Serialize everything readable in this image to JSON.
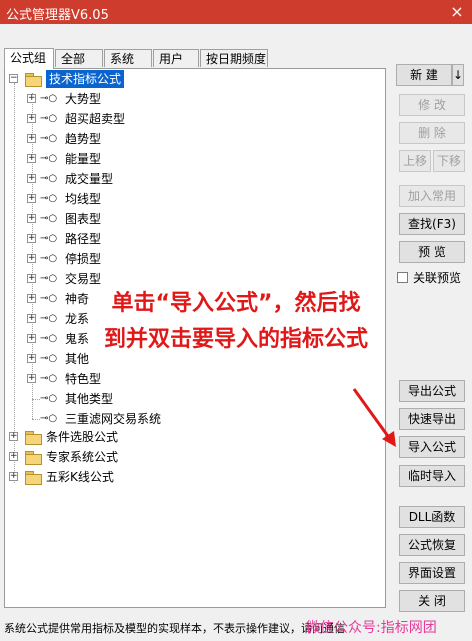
{
  "window": {
    "title": "公式管理器V6.05",
    "close_glyph": "×"
  },
  "tabs": [
    "公式组",
    "全部",
    "系统",
    "用户",
    "按日期频度"
  ],
  "tree": {
    "root_label": "技术指标公式",
    "children": [
      "大势型",
      "超买超卖型",
      "趋势型",
      "能量型",
      "成交量型",
      "均线型",
      "图表型",
      "路径型",
      "停损型",
      "交易型",
      "神奇",
      "龙系",
      "鬼系",
      "其他",
      "特色型",
      "其他类型",
      "三重滤网交易系统"
    ],
    "groups": [
      "条件选股公式",
      "专家系统公式",
      "五彩K线公式"
    ]
  },
  "buttons": {
    "new": "新 建",
    "new_arrow": "↓",
    "modify": "修 改",
    "delete": "删 除",
    "move_up": "上移",
    "move_down": "下移",
    "add_common": "加入常用",
    "find": "查找(F3)",
    "preview": "预 览",
    "linked_preview": "关联预览",
    "export": "导出公式",
    "quick_export": "快速导出",
    "import": "导入公式",
    "temp_import": "临时导入",
    "dll": "DLL函数",
    "restore": "公式恢复",
    "ui_settings": "界面设置",
    "close": "关 闭"
  },
  "status": "系统公式提供常用指标及模型的实现样本，不表示操作建议，请问通信",
  "overlay": {
    "line1": "单击“导入公式”，然后找",
    "line2": "到并双击要导入的指标公式"
  },
  "watermark": "微信公众号:指标网团",
  "colors": {
    "titlebar": "#cd3c2c",
    "selection": "#0a64cf",
    "annotation": "#e01818",
    "watermark": "#e83a9a"
  },
  "icons": {
    "folder": "folder-icon",
    "formula": "formula-key-icon",
    "arrow": "annotation-arrow-icon"
  }
}
